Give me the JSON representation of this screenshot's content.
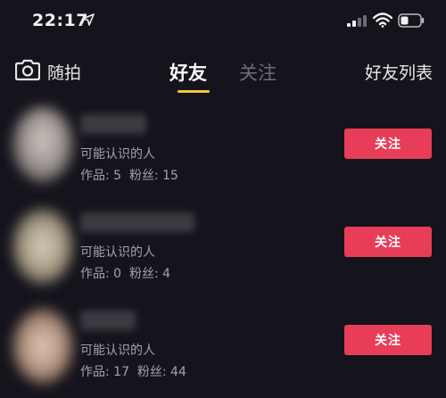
{
  "status_bar": {
    "time": "22:17",
    "icons": [
      "location-arrow-icon",
      "cellular-signal-icon",
      "wifi-icon",
      "battery-icon"
    ]
  },
  "top_nav": {
    "snap_label": "随拍",
    "tabs": [
      {
        "label": "好友",
        "active": true
      },
      {
        "label": "关注",
        "active": false
      }
    ],
    "friend_list_label": "好友列表",
    "indicator_color": "#f8c53a"
  },
  "suggestions": [
    {
      "reason": "可能认识的人",
      "works_label": "作品: 5",
      "fans_label": "粉丝: 15",
      "follow_label": "关注"
    },
    {
      "reason": "可能认识的人",
      "works_label": "作品: 0",
      "fans_label": "粉丝: 4",
      "follow_label": "关注"
    },
    {
      "reason": "可能认识的人",
      "works_label": "作品: 17",
      "fans_label": "粉丝: 44",
      "follow_label": "关注"
    }
  ],
  "colors": {
    "background": "#15141c",
    "follow_button": "#e83d58",
    "secondary_text": "#a3a2aa",
    "inactive_tab": "#6e6d75"
  }
}
